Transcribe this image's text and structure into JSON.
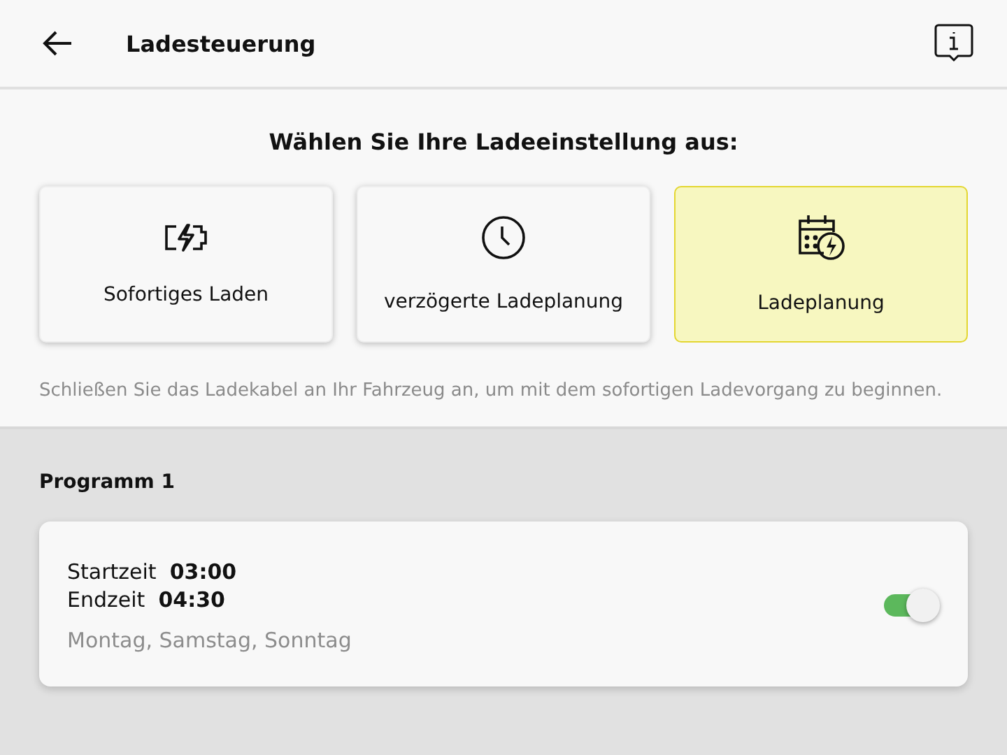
{
  "header": {
    "title": "Ladesteuerung"
  },
  "prompt": "Wählen Sie Ihre Ladeeinstellung aus:",
  "options": [
    {
      "kind": "battery",
      "label": "Sofortiges Laden",
      "selected": false
    },
    {
      "kind": "clock",
      "label": "verzögerte Ladeplanung",
      "selected": false
    },
    {
      "kind": "calendar",
      "label": "Ladeplanung",
      "selected": true
    }
  ],
  "hint": "Schließen Sie das Ladekabel an Ihr Fahrzeug an, um mit dem sofortigen Ladevorgang zu beginnen.",
  "programs": [
    {
      "title": "Programm 1",
      "times": [
        {
          "label": "Startzeit",
          "value": "03:00"
        },
        {
          "label": "Endzeit",
          "value": "04:30"
        }
      ],
      "days": "Montag, Samstag, Sonntag",
      "on": true
    }
  ]
}
